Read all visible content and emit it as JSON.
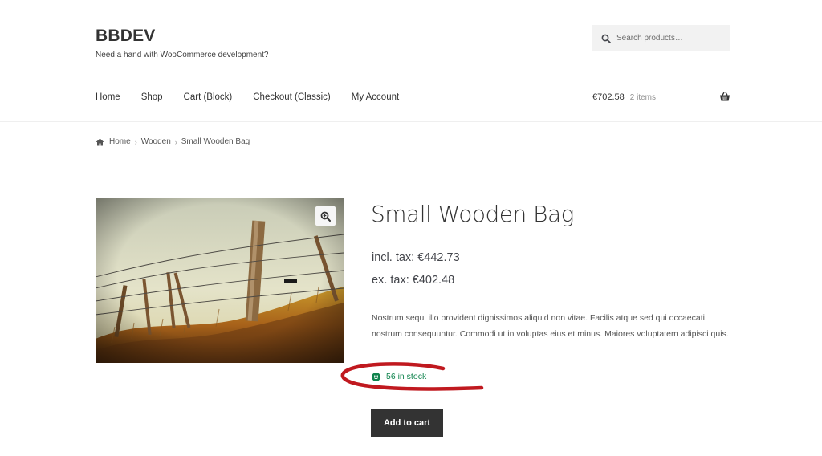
{
  "header": {
    "site_title": "BBDEV",
    "tagline": "Need a hand with WooCommerce development?",
    "search": {
      "placeholder": "Search products…",
      "icon": "search-icon"
    }
  },
  "nav": {
    "items": [
      {
        "label": "Home"
      },
      {
        "label": "Shop"
      },
      {
        "label": "Cart (Block)"
      },
      {
        "label": "Checkout (Classic)"
      },
      {
        "label": "My Account"
      }
    ]
  },
  "cart": {
    "total": "€702.58",
    "count": "2 items",
    "icon": "basket-icon"
  },
  "breadcrumb": {
    "items": [
      "Home",
      "Wooden"
    ],
    "current": "Small Wooden Bag",
    "separator": "›"
  },
  "product": {
    "title": "Small Wooden Bag",
    "price_incl": "incl. tax: €442.73",
    "price_ex": "ex. tax: €402.48",
    "description": "Nostrum sequi illo provident dignissimos aliquid non vitae. Facilis atque sed qui occaecati nostrum consequuntur. Commodi ut in voluptas eius et minus. Maiores voluptatem adipisci quis.",
    "stock": "56 in stock",
    "add_to_cart_label": "Add to cart"
  },
  "colors": {
    "accent_dark": "#333333",
    "stock_green": "#0f834d",
    "annotation_red": "#c0191f"
  }
}
